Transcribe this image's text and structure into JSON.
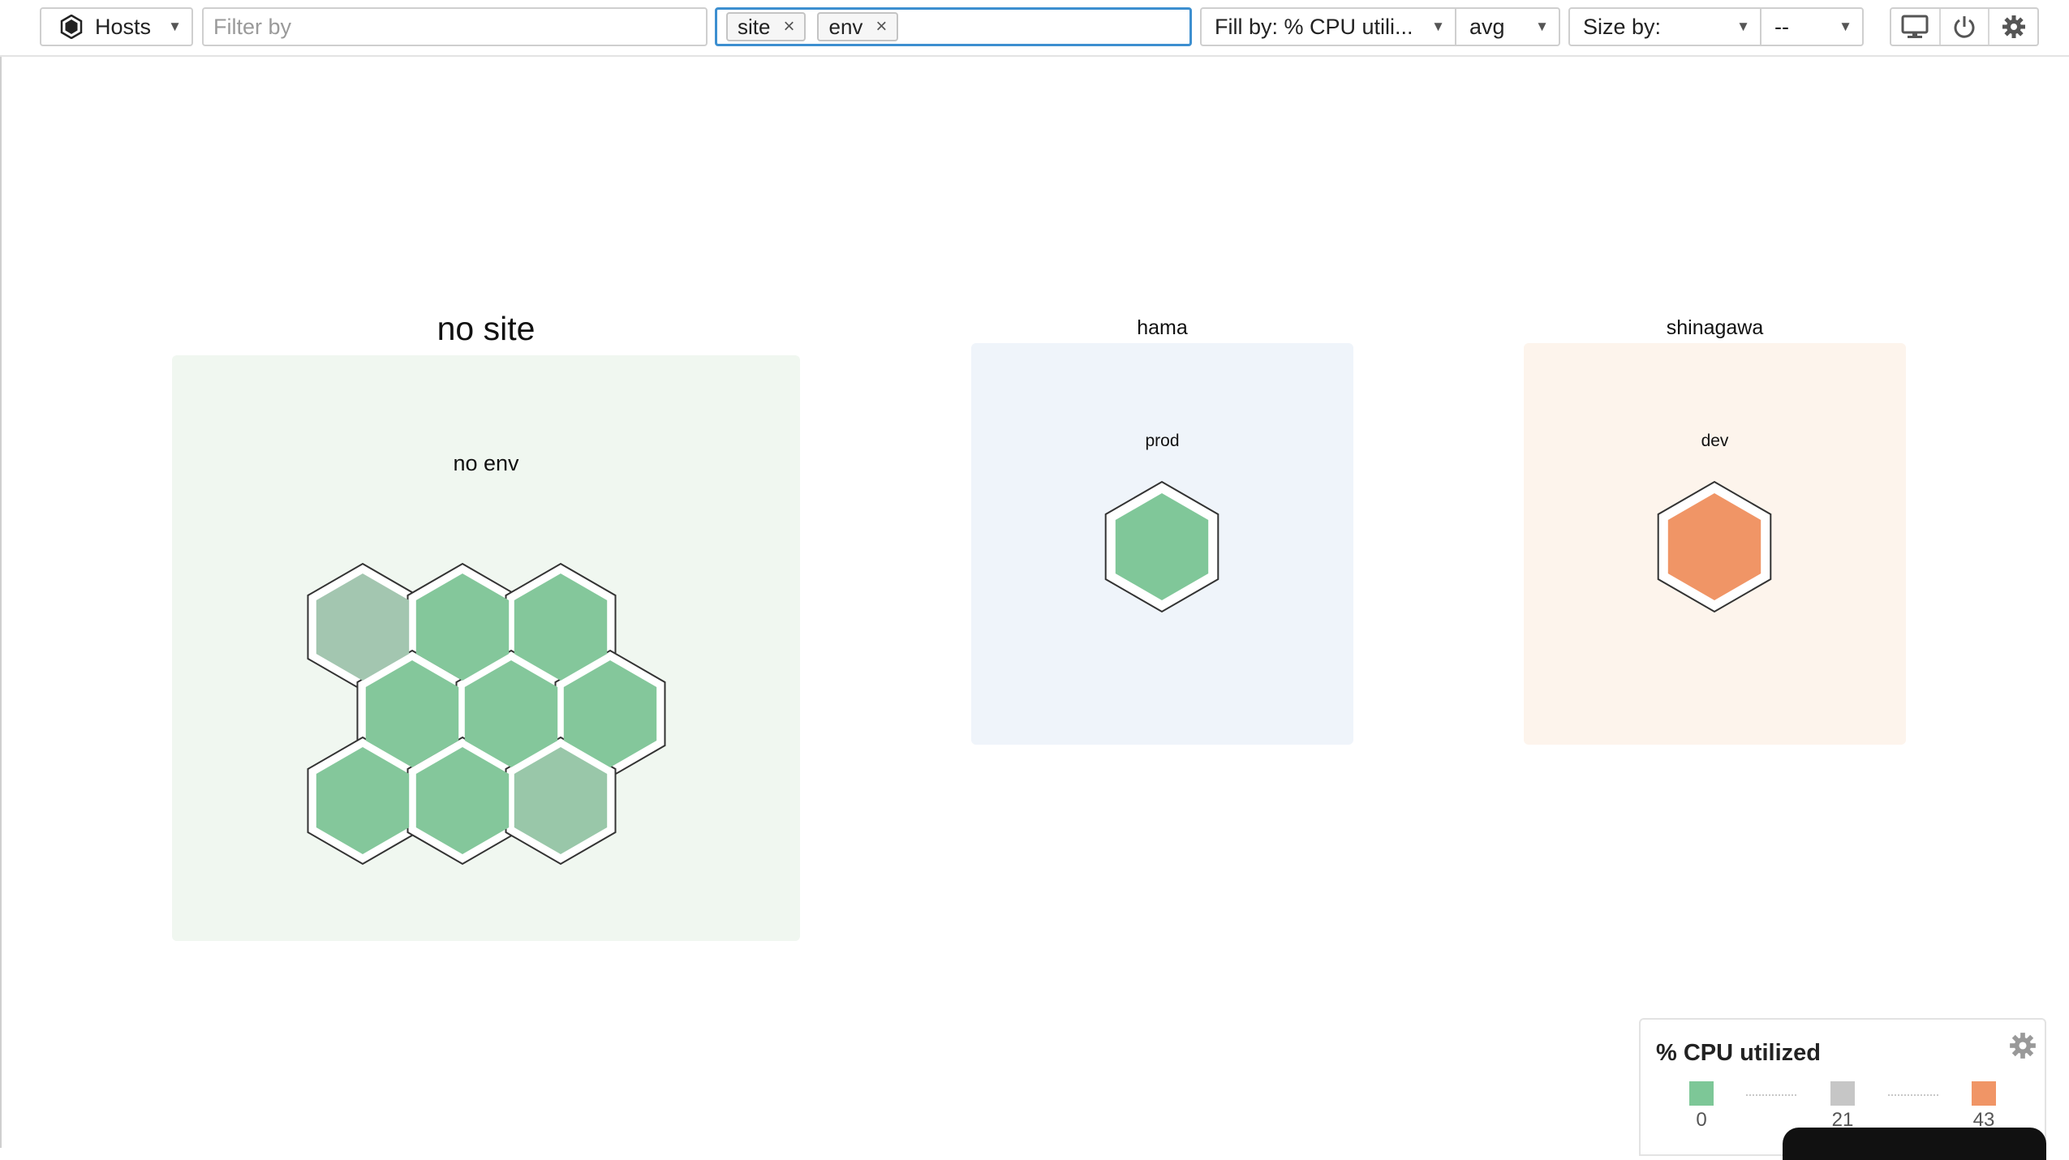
{
  "toolbar": {
    "entity_label": "Hosts",
    "filter_placeholder": "Filter by",
    "group_by_tags": [
      "site",
      "env"
    ],
    "fill_label": "Fill by: % CPU utili...",
    "aggregation": "avg",
    "size_label": "Size by:",
    "size_value": "--"
  },
  "groups": [
    {
      "title": "no site",
      "sub": "no env",
      "hosts": [
        {
          "cpu_pct": 11
        },
        {
          "cpu_pct": 2
        },
        {
          "cpu_pct": 2
        },
        {
          "cpu_pct": 2
        },
        {
          "cpu_pct": 2
        },
        {
          "cpu_pct": 2
        },
        {
          "cpu_pct": 2
        },
        {
          "cpu_pct": 2
        },
        {
          "cpu_pct": 8
        }
      ]
    },
    {
      "title": "hama",
      "sub": "prod",
      "hosts": [
        {
          "cpu_pct": 1
        }
      ]
    },
    {
      "title": "shinagawa",
      "sub": "dev",
      "hosts": [
        {
          "cpu_pct": 43
        }
      ]
    }
  ],
  "legend": {
    "title": "% CPU utilized",
    "stops": [
      "0",
      "21",
      "43"
    ],
    "colors": {
      "low": "#7dc797",
      "mid": "#c6c6c6",
      "high": "#f09566"
    }
  }
}
